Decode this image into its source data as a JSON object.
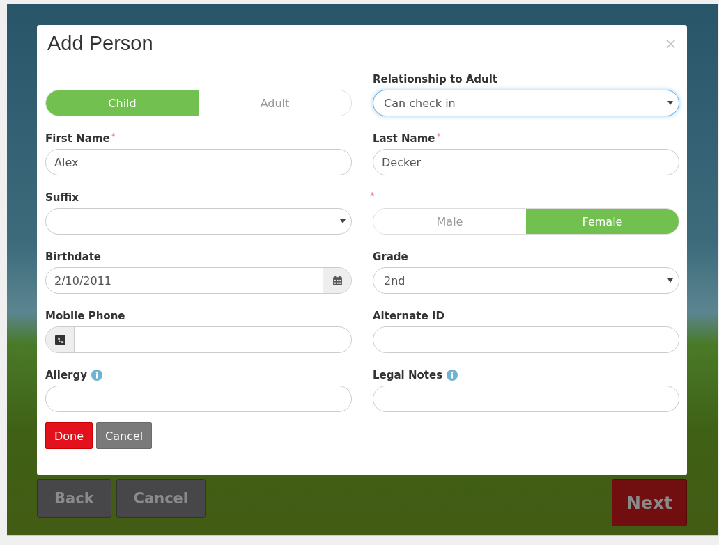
{
  "dialog": {
    "title": "Add Person",
    "close": "×",
    "rows": [
      [
        {
          "kind": "segmented",
          "options": [
            {
              "label": "Child",
              "selected": true
            },
            {
              "label": "Adult",
              "selected": false
            }
          ]
        },
        {
          "kind": "select",
          "label": "Relationship to Adult",
          "value": "Can check in",
          "focused": true
        }
      ],
      [
        {
          "kind": "text",
          "label": "First Name",
          "required_mark": "*",
          "value": "Alex"
        },
        {
          "kind": "text",
          "label": "Last Name",
          "required_mark": "*",
          "value": "Decker"
        }
      ],
      [
        {
          "kind": "select",
          "label": "Suffix",
          "focused": false
        },
        {
          "kind": "segmented",
          "required_mark": "*",
          "options": [
            {
              "label": "Male",
              "selected": false
            },
            {
              "label": "Female",
              "selected": true
            }
          ]
        }
      ],
      [
        {
          "kind": "date",
          "label": "Birthdate",
          "value": "2/10/2011"
        },
        {
          "kind": "select",
          "label": "Grade",
          "value": "2nd",
          "focused": false
        }
      ],
      [
        {
          "kind": "phone",
          "label": "Mobile Phone"
        },
        {
          "kind": "text",
          "label": "Alternate ID"
        }
      ],
      [
        {
          "kind": "text",
          "label": "Allergy",
          "info": true
        },
        {
          "kind": "text",
          "label": "Legal Notes",
          "info": true
        }
      ]
    ],
    "actions": [
      {
        "label": "Done",
        "kind": "primary"
      },
      {
        "label": "Cancel",
        "kind": "secondary"
      }
    ]
  },
  "footer": [
    {
      "label": "Back",
      "kind": "secondary"
    },
    {
      "label": "Cancel",
      "kind": "secondary"
    },
    {
      "label": "Next",
      "kind": "primary"
    }
  ]
}
